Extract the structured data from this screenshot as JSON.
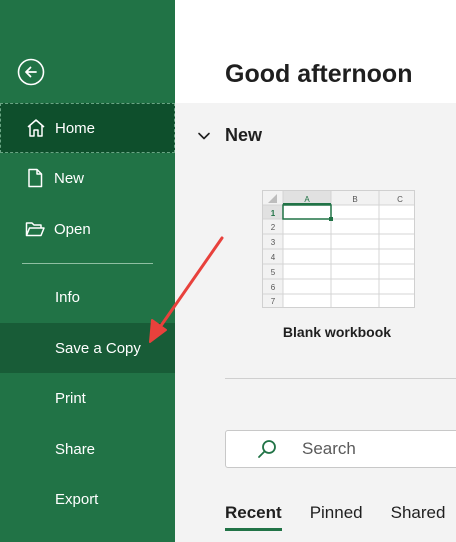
{
  "sidebar": {
    "items": [
      {
        "label": "Home",
        "icon": "home-icon"
      },
      {
        "label": "New",
        "icon": "new-document-icon"
      },
      {
        "label": "Open",
        "icon": "folder-open-icon"
      },
      {
        "label": "Info"
      },
      {
        "label": "Save a Copy"
      },
      {
        "label": "Print"
      },
      {
        "label": "Share"
      },
      {
        "label": "Export"
      }
    ]
  },
  "main": {
    "greeting": "Good afternoon",
    "new_section": {
      "title": "New",
      "template": {
        "label": "Blank workbook",
        "columns": [
          "A",
          "B",
          "C"
        ],
        "rows": [
          "1",
          "2",
          "3",
          "4",
          "5",
          "6",
          "7"
        ]
      }
    },
    "search": {
      "placeholder": "Search"
    },
    "tabs": [
      {
        "label": "Recent",
        "active": true
      },
      {
        "label": "Pinned"
      },
      {
        "label": "Shared"
      }
    ]
  },
  "colors": {
    "sidebar_bg": "#217346",
    "active_item_bg": "#0e4f2c",
    "highlight_item_bg": "#185c37",
    "annotation_arrow": "#e8413c"
  }
}
